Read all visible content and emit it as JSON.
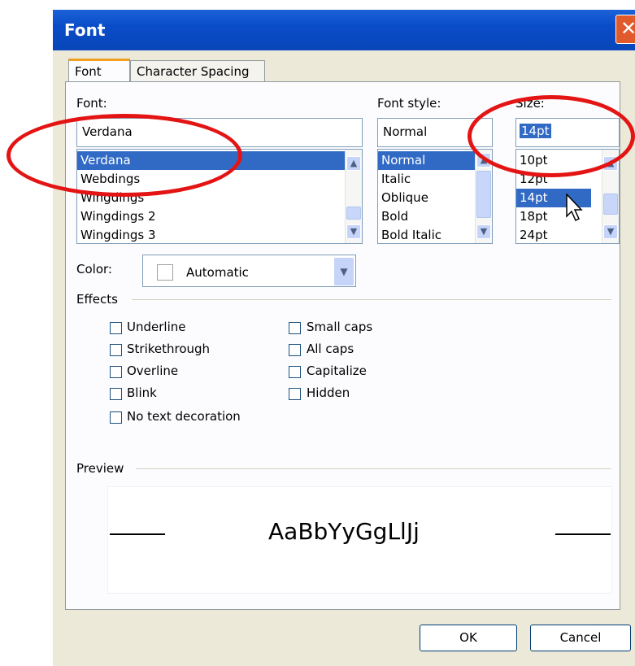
{
  "window": {
    "title": "Font",
    "close_glyph": "✕"
  },
  "tabs": [
    {
      "label": "Font",
      "active": true
    },
    {
      "label": "Character Spacing",
      "active": false
    }
  ],
  "font": {
    "label": "Font:",
    "value": "Verdana",
    "items": [
      "Verdana",
      "Webdings",
      "Wingdings",
      "Wingdings 2",
      "Wingdings 3"
    ],
    "selected": "Verdana"
  },
  "style": {
    "label": "Font style:",
    "value": "Normal",
    "items": [
      "Normal",
      "Italic",
      "Oblique",
      "Bold",
      "Bold Italic"
    ],
    "selected": "Normal"
  },
  "size": {
    "label": "Size:",
    "value": "14pt",
    "items": [
      "10pt",
      "12pt",
      "14pt",
      "18pt",
      "24pt"
    ],
    "selected": "14pt"
  },
  "color": {
    "label": "Color:",
    "value": "Automatic"
  },
  "effects": {
    "label": "Effects",
    "left": [
      "Underline",
      "Strikethrough",
      "Overline",
      "Blink",
      "No text decoration"
    ],
    "right": [
      "Small caps",
      "All caps",
      "Capitalize",
      "Hidden"
    ]
  },
  "preview": {
    "label": "Preview",
    "sample": "AaBbYyGgLlJj"
  },
  "buttons": {
    "ok": "OK",
    "cancel": "Cancel"
  },
  "icons": {
    "scroll_up": "scroll-up-icon",
    "scroll_down": "scroll-down-icon",
    "dropdown": "chevron-down-icon",
    "cursor": "mouse-cursor-icon",
    "close": "close-icon"
  },
  "colors": {
    "titlebar": "#0a4cc8",
    "selection": "#316ac5",
    "annotation": "#e41414",
    "close": "#e05a2b"
  }
}
